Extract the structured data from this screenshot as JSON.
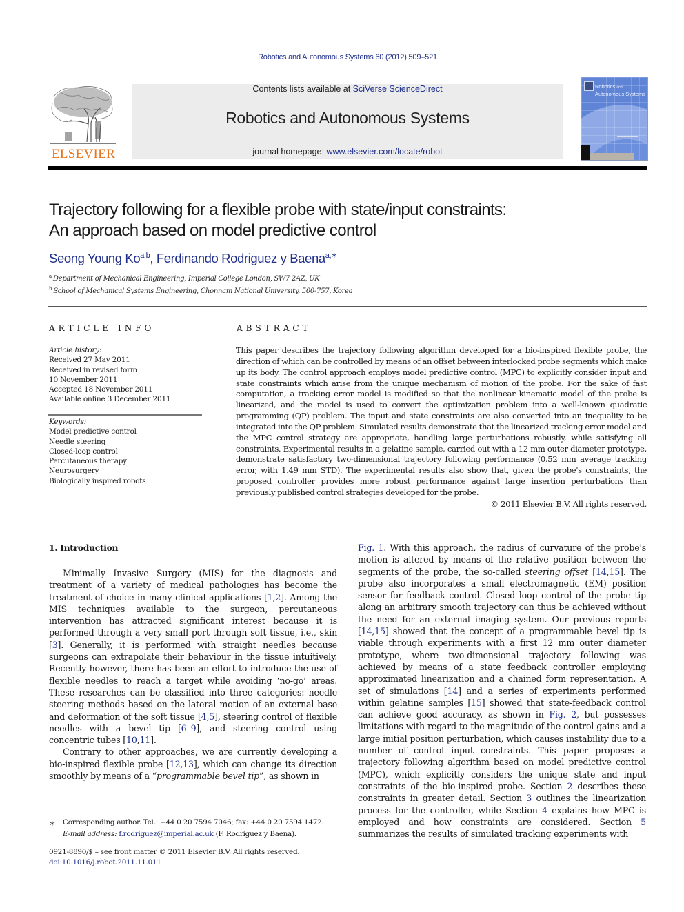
{
  "header": {
    "journal_ref": "Robotics and Autonomous Systems 60 (2012) 509–521",
    "publisher_logo_text": "ELSEVIER",
    "contents_prefix": "Contents lists available at ",
    "contents_link": "SciVerse ScienceDirect",
    "journal_title": "Robotics and Autonomous Systems",
    "homepage_prefix": "journal homepage: ",
    "homepage_link": "www.elsevier.com/locate/robot",
    "cover_title_line1": "Robotics",
    "cover_title_and": "and",
    "cover_title_line2": "Autonomous Systems"
  },
  "article": {
    "title_line1": "Trajectory following for a flexible probe with state/input constraints:",
    "title_line2": "An approach based on model predictive control",
    "authors": [
      {
        "name": "Seong Young Ko",
        "sup": "a,b"
      },
      {
        "name": "Ferdinando Rodriguez y Baena",
        "sup": "a,∗"
      }
    ],
    "author_separator": ", ",
    "affiliations": [
      {
        "mark": "a",
        "text": "Department of Mechanical Engineering, Imperial College London, SW7 2AZ, UK"
      },
      {
        "mark": "b",
        "text": "School of Mechanical Systems Engineering, Chonnam National University, 500-757, Korea"
      }
    ]
  },
  "article_info": {
    "heading": "ARTICLE INFO",
    "history_label": "Article history:",
    "history": [
      "Received 27 May 2011",
      "Received in revised form",
      "10 November 2011",
      "Accepted 18 November 2011",
      "Available online 3 December 2011"
    ],
    "keywords_label": "Keywords:",
    "keywords": [
      "Model predictive control",
      "Needle steering",
      "Closed-loop control",
      "Percutaneous therapy",
      "Neurosurgery",
      "Biologically inspired robots"
    ]
  },
  "abstract": {
    "heading": "ABSTRACT",
    "text": "This paper describes the trajectory following algorithm developed for a bio-inspired flexible probe, the direction of which can be controlled by means of an offset between interlocked probe segments which make up its body. The control approach employs model predictive control (MPC) to explicitly consider input and state constraints which arise from the unique mechanism of motion of the probe. For the sake of fast computation, a tracking error model is modified so that the nonlinear kinematic model of the probe is linearized, and the model is used to convert the optimization problem into a well-known quadratic programming (QP) problem. The input and state constraints are also converted into an inequality to be integrated into the QP problem. Simulated results demonstrate that the linearized tracking error model and the MPC control strategy are appropriate, handling large perturbations robustly, while satisfying all constraints. Experimental results in a gelatine sample, carried out with a 12 mm outer diameter prototype, demonstrate satisfactory two-dimensional trajectory following performance (0.52 mm average tracking error, with 1.49 mm STD). The experimental results also show that, given the probe's constraints, the proposed controller provides more robust performance against large insertion perturbations than previously published control strategies developed for the probe.",
    "copyright": "© 2011 Elsevier B.V. All rights reserved."
  },
  "intro": {
    "heading": "1.  Introduction",
    "left_p1": [
      {
        "t": "Minimally Invasive Surgery (MIS) for the diagnosis and treatment of a variety of medical pathologies has become the treatment of choice in many clinical applications "
      },
      {
        "t": "[",
        "k": "text"
      },
      {
        "t": "1",
        "k": "link"
      },
      {
        "t": ",",
        "k": "text"
      },
      {
        "t": "2",
        "k": "link"
      },
      {
        "t": "]",
        "k": "text"
      },
      {
        "t": ". Among the MIS techniques available to the surgeon, percutaneous intervention has attracted significant interest because it is performed through a very small port through soft tissue, i.e., skin "
      },
      {
        "t": "[",
        "k": "text"
      },
      {
        "t": "3",
        "k": "link"
      },
      {
        "t": "]",
        "k": "text"
      },
      {
        "t": ". Generally, it is performed with straight needles because surgeons can extrapolate their behaviour in the tissue intuitively. Recently however, there has been an effort to introduce the use of flexible needles to reach a target while avoiding ‘no-go’ areas. These researches can be classified into three categories: needle steering methods based on the lateral motion of an external base and deformation of the soft tissue "
      },
      {
        "t": "[",
        "k": "text"
      },
      {
        "t": "4",
        "k": "link"
      },
      {
        "t": ",",
        "k": "text"
      },
      {
        "t": "5",
        "k": "link"
      },
      {
        "t": "]",
        "k": "text"
      },
      {
        "t": ", steering control of flexible needles with a bevel tip "
      },
      {
        "t": "[",
        "k": "text"
      },
      {
        "t": "6–9",
        "k": "link"
      },
      {
        "t": "]",
        "k": "text"
      },
      {
        "t": ", and steering control using concentric tubes "
      },
      {
        "t": "[",
        "k": "text"
      },
      {
        "t": "10",
        "k": "link"
      },
      {
        "t": ",",
        "k": "text"
      },
      {
        "t": "11",
        "k": "link"
      },
      {
        "t": "]",
        "k": "text"
      },
      {
        "t": "."
      }
    ],
    "left_p2": [
      {
        "t": "Contrary to other approaches, we are currently developing a bio-inspired flexible probe "
      },
      {
        "t": "[",
        "k": "text"
      },
      {
        "t": "12",
        "k": "link"
      },
      {
        "t": ",",
        "k": "text"
      },
      {
        "t": "13",
        "k": "link"
      },
      {
        "t": "]",
        "k": "text"
      },
      {
        "t": ", which can change its direction smoothly by means of a “"
      },
      {
        "t": "programmable bevel tip",
        "k": "em"
      },
      {
        "t": "”, as shown in"
      }
    ],
    "right_p1": [
      {
        "t": "Fig. 1",
        "k": "link"
      },
      {
        "t": ". With this approach, the radius of curvature of the probe's motion is altered by means of the relative position between the segments of the probe, the so-called "
      },
      {
        "t": "steering offset",
        "k": "em"
      },
      {
        "t": " [",
        "k": "text"
      },
      {
        "t": "14",
        "k": "link"
      },
      {
        "t": ",",
        "k": "text"
      },
      {
        "t": "15",
        "k": "link"
      },
      {
        "t": "]",
        "k": "text"
      },
      {
        "t": ". The probe also incorporates a small electromagnetic (EM) position sensor for feedback control. Closed loop control of the probe tip along an arbitrary smooth trajectory can thus be achieved without the need for an external imaging system. Our previous reports "
      },
      {
        "t": "[",
        "k": "text"
      },
      {
        "t": "14",
        "k": "link"
      },
      {
        "t": ",",
        "k": "text"
      },
      {
        "t": "15",
        "k": "link"
      },
      {
        "t": "]",
        "k": "text"
      },
      {
        "t": " showed that the concept of a programmable bevel tip is viable through experiments with a first 12 mm outer diameter prototype, where two-dimensional trajectory following was achieved by means of a state feedback controller employing approximated linearization and a chained form representation. A set of simulations "
      },
      {
        "t": "[",
        "k": "text"
      },
      {
        "t": "14",
        "k": "link"
      },
      {
        "t": "]",
        "k": "text"
      },
      {
        "t": " and a series of experiments performed within gelatine samples "
      },
      {
        "t": "[",
        "k": "text"
      },
      {
        "t": "15",
        "k": "link"
      },
      {
        "t": "]",
        "k": "text"
      },
      {
        "t": " showed that state-feedback control can achieve good accuracy, as shown in "
      },
      {
        "t": "Fig. 2",
        "k": "link"
      },
      {
        "t": ", but possesses limitations with regard to the magnitude of the control gains and a large initial position perturbation, which causes instability due to a number of control input constraints. This paper proposes a trajectory following algorithm based on model predictive control (MPC), which explicitly considers the unique state and input constraints of the bio-inspired probe. Section "
      },
      {
        "t": "2",
        "k": "link"
      },
      {
        "t": " describes these constraints in greater detail. Section "
      },
      {
        "t": "3",
        "k": "link"
      },
      {
        "t": " outlines the linearization process for the controller, while Section "
      },
      {
        "t": "4",
        "k": "link"
      },
      {
        "t": " explains how MPC is employed and how constraints are considered. Section "
      },
      {
        "t": "5",
        "k": "link"
      },
      {
        "t": " summarizes the results of simulated tracking experiments with"
      }
    ]
  },
  "footnote": {
    "star": "∗",
    "corresponding": "Corresponding author. Tel.: +44 0 20 7594 7046; fax: +44 0 20 7594 1472.",
    "email_label": "E-mail address:",
    "email": "f.rodriguez@imperial.ac.uk",
    "email_suffix": " (F. Rodriguez y Baena)."
  },
  "front_matter": {
    "issn_line": "0921-8890/$ – see front matter © 2011 Elsevier B.V. All rights reserved.",
    "doi": "doi:10.1016/j.robot.2011.11.011"
  },
  "colors": {
    "link": "#1f2f8a",
    "elsevier_orange": "#e8741b",
    "masthead_bg": "#ececec",
    "cover_blue": "#5f84d6"
  }
}
